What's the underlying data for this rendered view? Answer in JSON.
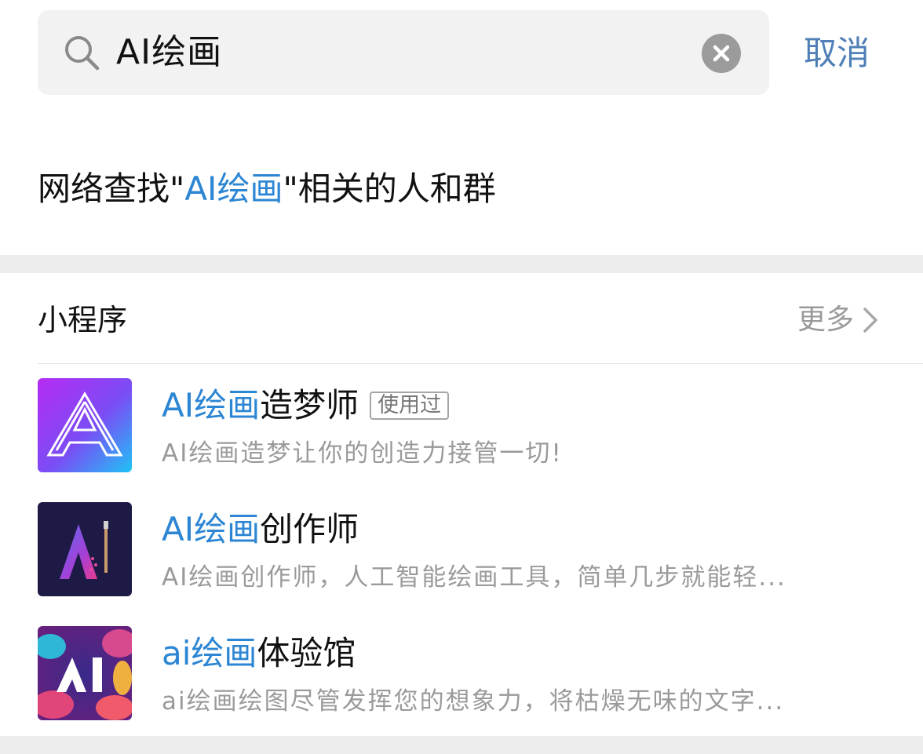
{
  "search": {
    "query": "AI绘画",
    "cancel_label": "取消"
  },
  "network_search": {
    "prefix": "网络查找\"",
    "keyword": "AI绘画",
    "suffix": "\"相关的人和群"
  },
  "section": {
    "title": "小程序",
    "more_label": "更多"
  },
  "mini_programs": [
    {
      "name_highlight": "AI绘画",
      "name_rest": "造梦师",
      "badge": "使用过",
      "desc": "AI绘画造梦让你的创造力接管一切!"
    },
    {
      "name_highlight": "AI绘画",
      "name_rest": "创作师",
      "desc": "AI绘画创作师，人工智能绘画工具，简单几步就能轻..."
    },
    {
      "name_highlight": "ai绘画",
      "name_rest": "体验馆",
      "desc": "ai绘画绘图尽管发挥您的想象力，将枯燥无味的文字..."
    }
  ],
  "colors": {
    "highlight": "#2c86d3",
    "cancel": "#4f7fb6",
    "search_bg": "#f2f2f2",
    "secondary_text": "#9a9a9a"
  }
}
